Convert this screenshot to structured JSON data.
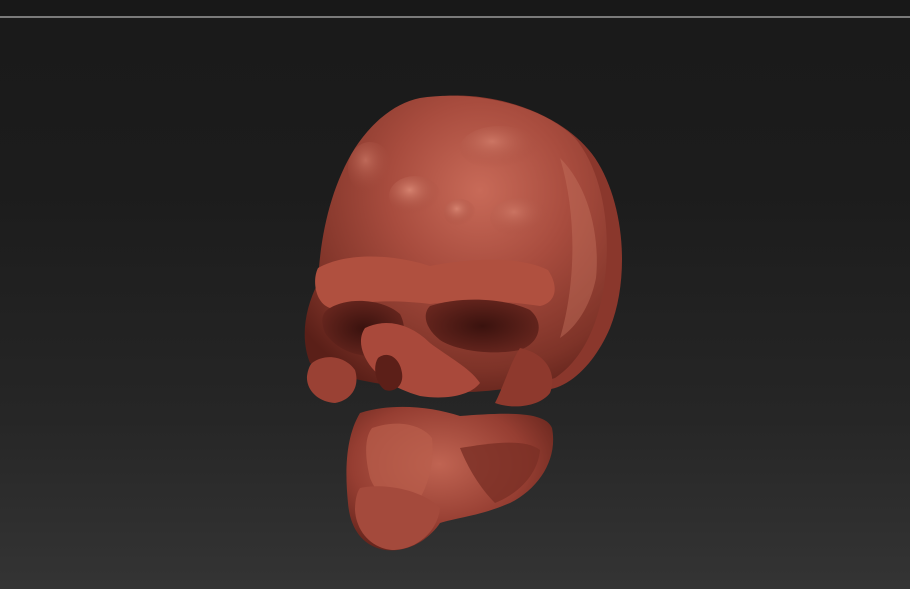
{
  "viewport": {
    "model_name": "sculpted-skull",
    "background": {
      "top": "#1a1a1a",
      "bottom": "#343434"
    },
    "material_color": "#a0463a",
    "highlight_color": "#d07a68",
    "shadow_color": "#5a1f18"
  },
  "topbar": {
    "divider_color": "#7a7a7a"
  }
}
